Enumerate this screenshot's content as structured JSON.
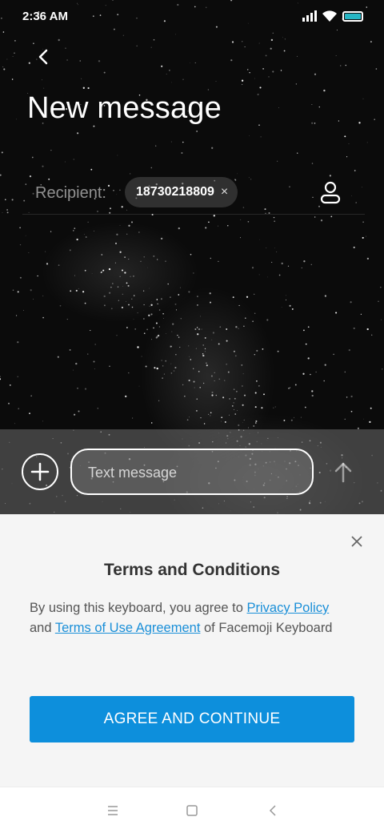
{
  "status_bar": {
    "time": "2:36 AM",
    "icons": [
      "signal-icon",
      "wifi-icon",
      "battery-icon"
    ],
    "battery_color": "#27b6c4"
  },
  "header": {
    "back_icon": "chevron-left-icon",
    "title": "New message"
  },
  "recipient": {
    "label": "Recipient:",
    "number": "18730218809",
    "remove_icon": "×",
    "contact_icon": "person-icon"
  },
  "composer": {
    "attach_icon": "plus-icon",
    "placeholder": "Text message",
    "send_icon": "arrow-up-icon"
  },
  "terms": {
    "close_icon": "close-icon",
    "title": "Terms and Conditions",
    "body_prefix": "By using this keyboard, you agree to ",
    "privacy_link": "Privacy Policy",
    "and_text": " and ",
    "terms_link": "Terms of Use Agreement",
    "body_suffix": " of Facemoji Keyboard",
    "agree_button": "AGREE AND CONTINUE",
    "link_color": "#1a8fd8",
    "button_color": "#0d8fdc"
  },
  "nav_bar": {
    "items": [
      "menu-icon",
      "home-icon",
      "back-icon"
    ]
  }
}
